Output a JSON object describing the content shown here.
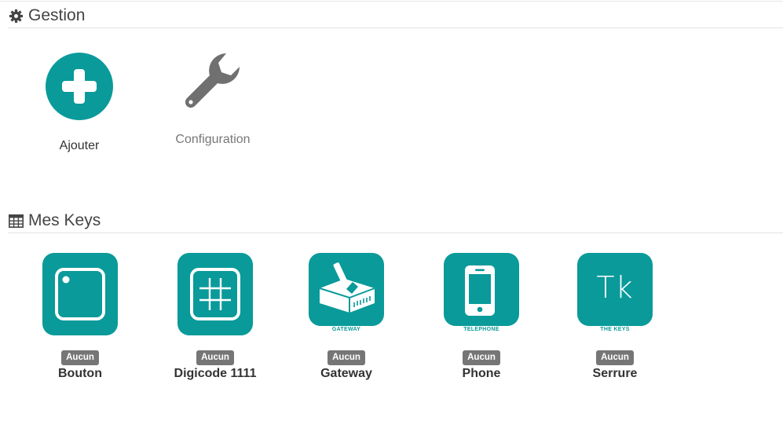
{
  "gestion": {
    "title": "Gestion",
    "icon": "gear-icon",
    "actions": [
      {
        "label": "Ajouter",
        "icon": "plus-circle-icon"
      },
      {
        "label": "Configuration",
        "icon": "wrench-icon"
      }
    ]
  },
  "keys": {
    "title": "Mes Keys",
    "icon": "table-icon",
    "items": [
      {
        "name": "Bouton",
        "badge": "Aucun",
        "icon": "button-square-icon",
        "sublabel": ""
      },
      {
        "name": "Digicode 1111",
        "badge": "Aucun",
        "icon": "keypad-grid-icon",
        "sublabel": ""
      },
      {
        "name": "Gateway",
        "badge": "Aucun",
        "icon": "gateway-icon",
        "sublabel": "GATEWAY"
      },
      {
        "name": "Phone",
        "badge": "Aucun",
        "icon": "phone-icon",
        "sublabel": "TELEPHONE"
      },
      {
        "name": "Serrure",
        "badge": "Aucun",
        "icon": "the-keys-logo-icon",
        "sublabel": "THE KEYS",
        "logo_text": "Tk"
      }
    ]
  },
  "colors": {
    "accent": "#0a9a9a",
    "badge": "#767676",
    "icon_grey": "#707070"
  }
}
